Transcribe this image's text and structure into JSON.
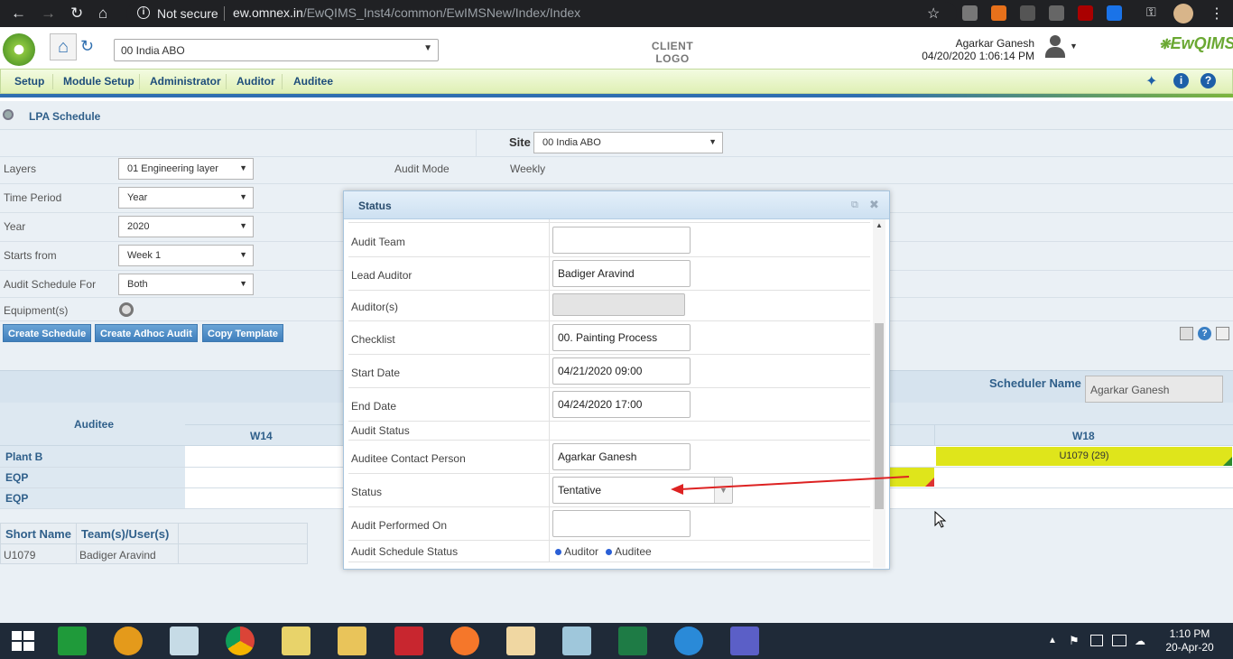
{
  "browser": {
    "status": "Not secure",
    "url_domain": "ew.omnex.in",
    "url_path": "/EwQIMS_Inst4/common/EwIMSNew/Index/Index"
  },
  "header": {
    "site": "00 India ABO",
    "client_logo": "CLIENT LOGO",
    "user_name": "Agarkar Ganesh",
    "datetime": "04/20/2020 1:06:14 PM",
    "brand": "EwQIMS"
  },
  "menu": [
    "Setup",
    "Module Setup",
    "Administrator",
    "Auditor",
    "Auditee"
  ],
  "page": {
    "title": "LPA Schedule"
  },
  "form": {
    "site_label": "Site",
    "site_value": "00 India ABO",
    "layers_label": "Layers",
    "layers_value": "01 Engineering layer",
    "audit_mode_label": "Audit Mode",
    "audit_mode_value": "Weekly",
    "time_period_label": "Time Period",
    "time_period_value": "Year",
    "year_label": "Year",
    "year_value": "2020",
    "starts_from_label": "Starts from",
    "starts_from_value": "Week 1",
    "schedule_for_label": "Audit Schedule For",
    "schedule_for_value": "Both",
    "equipment_label": "Equipment(s)"
  },
  "buttons": {
    "create": "Create Schedule",
    "adhoc": "Create Adhoc Audit",
    "copy": "Copy Template"
  },
  "scheduler": {
    "label": "Scheduler Name",
    "value": "Agarkar Ganesh"
  },
  "grid": {
    "auditee_header": "Auditee",
    "w14": "W14",
    "w18": "W18",
    "rows": [
      "Plant B",
      "EQP",
      "EQP"
    ],
    "cell_w18": "U1079 (29)"
  },
  "legend": {
    "short_name": "Short Name",
    "team": "Team(s)/User(s)",
    "row_short": "U1079",
    "row_team": "Badiger Aravind"
  },
  "modal": {
    "title": "Status",
    "audit_team_label": "Audit Team",
    "lead_auditor_label": "Lead Auditor",
    "lead_auditor_value": "Badiger Aravind",
    "auditors_label": "Auditor(s)",
    "checklist_label": "Checklist",
    "checklist_value": "00. Painting Process",
    "start_label": "Start Date",
    "start_value": "04/21/2020 09:00",
    "end_label": "End Date",
    "end_value": "04/24/2020 17:00",
    "audit_status_label": "Audit Status",
    "contact_label": "Auditee Contact Person",
    "contact_value": "Agarkar Ganesh",
    "status_label": "Status",
    "status_value": "Tentative",
    "performed_label": "Audit Performed On",
    "schedule_status_label": "Audit Schedule Status",
    "auditor_text": "Auditor",
    "auditee_text": "Auditee"
  },
  "taskbar": {
    "time": "1:10 PM",
    "date": "20-Apr-20"
  }
}
